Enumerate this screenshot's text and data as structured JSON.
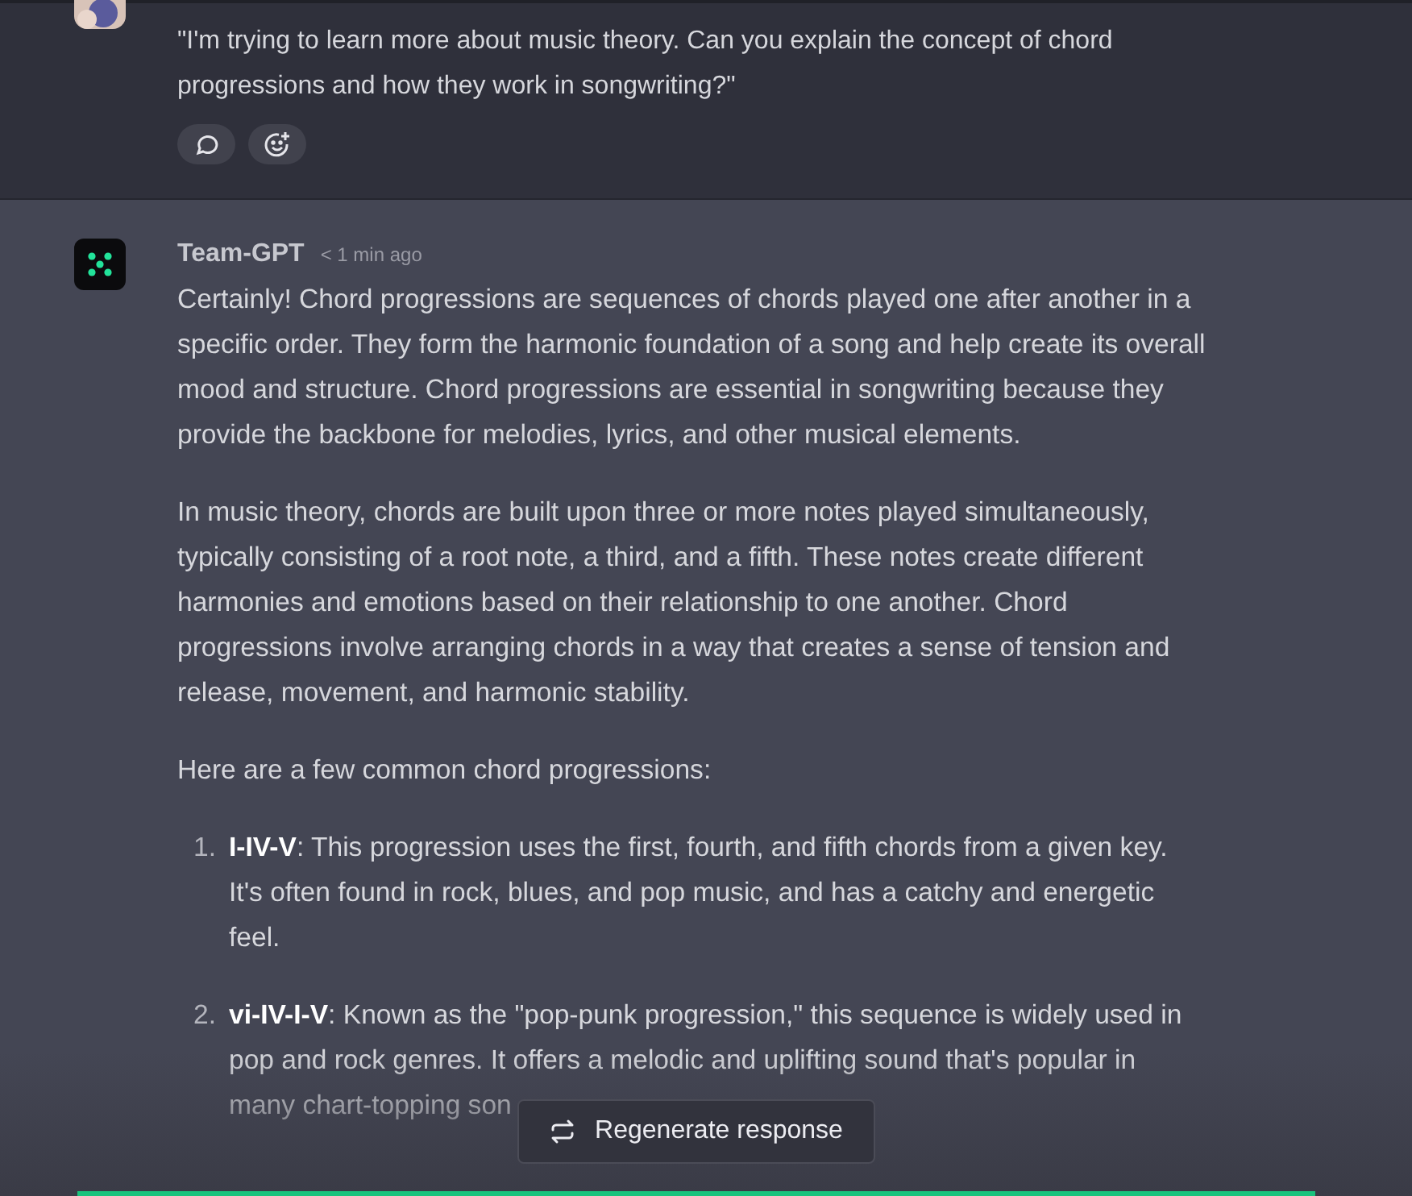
{
  "user_message": {
    "text": "\"I'm trying to learn more about music theory. Can you explain the concept of chord progressions and how they work in songwriting?\""
  },
  "assistant_message": {
    "author": "Team-GPT",
    "time": "< 1 min ago",
    "paragraphs": [
      "Certainly! Chord progressions are sequences of chords played one after another in a specific order. They form the harmonic foundation of a song and help create its overall mood and structure. Chord progressions are essential in songwriting because they provide the backbone for melodies, lyrics, and other musical elements.",
      "In music theory, chords are built upon three or more notes played simultaneously, typically consisting of a root note, a third, and a fifth. These notes create different harmonies and emotions based on their relationship to one another. Chord progressions involve arranging chords in a way that creates a sense of tension and release, movement, and harmonic stability.",
      "Here are a few common chord progressions:"
    ],
    "list": [
      {
        "number": "1.",
        "text": "**I-IV-V**: This progression uses the first, fourth, and fifth chords from a given key. It's often found in rock, blues, and pop music, and has a catchy and energetic feel."
      },
      {
        "number": "2.",
        "text": "**vi-IV-I-V**: Known as the \"pop-punk progression,\" this sequence is widely used in pop and rock genres. It offers a melodic and uplifting sound that's popular in many chart-topping son"
      }
    ]
  },
  "regenerate_button": {
    "label": "Regenerate response"
  }
}
